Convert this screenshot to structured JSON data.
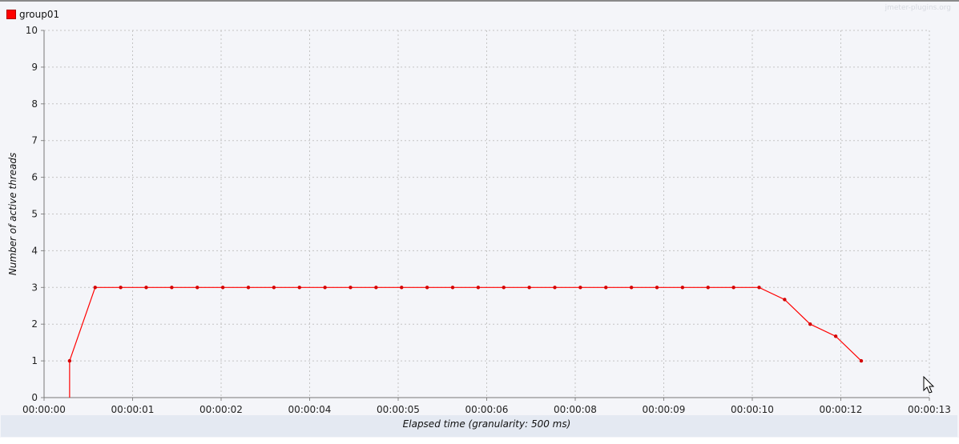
{
  "chart_data": {
    "type": "line",
    "title": "",
    "xlabel": "Elapsed time (granularity: 500 ms)",
    "ylabel": "Number of active threads",
    "ylim": [
      0,
      10
    ],
    "yticks": [
      "0",
      "1",
      "2",
      "3",
      "4",
      "5",
      "6",
      "7",
      "8",
      "9",
      "10"
    ],
    "xticks": [
      "00:00:00",
      "00:00:01",
      "00:00:02",
      "00:00:04",
      "00:00:05",
      "00:00:06",
      "00:00:08",
      "00:00:09",
      "00:00:10",
      "00:00:12",
      "00:00:13"
    ],
    "grid": true,
    "legend_position": "top-left",
    "series": [
      {
        "name": "group01",
        "color": "#ff0000",
        "x_ms": [
          375,
          750,
          1125,
          1500,
          1875,
          2250,
          2625,
          3000,
          3375,
          3750,
          4125,
          4500,
          4875,
          5250,
          5625,
          6000,
          6375,
          6750,
          7125,
          7500,
          7875,
          8250,
          8625,
          9000,
          9375,
          9750,
          10125,
          10500,
          10875,
          11250,
          11625,
          12000
        ],
        "values": [
          1,
          3,
          3,
          3,
          3,
          3,
          3,
          3,
          3,
          3,
          3,
          3,
          3,
          3,
          3,
          3,
          3,
          3,
          3,
          3,
          3,
          3,
          3,
          3,
          3,
          3,
          3,
          3,
          2.67,
          2,
          1.67,
          1
        ]
      }
    ]
  },
  "watermark": "jmeter-plugins.org"
}
